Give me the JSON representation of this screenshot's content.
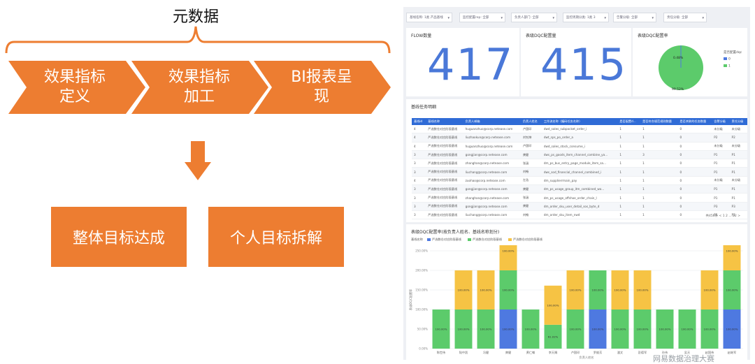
{
  "diagram": {
    "metadata_label": "元数据",
    "pipeline": [
      {
        "label": "效果指标定义",
        "line1": "效果指标",
        "line2": "定义"
      },
      {
        "label": "效果指标加工",
        "line1": "效果指标",
        "line2": "加工"
      },
      {
        "label": "BI报表呈现",
        "line1": "BI报表呈",
        "line2": "现"
      }
    ],
    "outcomes": [
      "整体目标达成",
      "个人目标拆解"
    ],
    "colors": {
      "accent": "#ed7d31"
    }
  },
  "dashboard": {
    "filters": [
      "基线名称: 1类 产品基线",
      "监控配置rep: 全部",
      "负责人部门: 全部",
      "监控周期分类: 1类 3",
      "告警分级: 全部",
      "责任分级: 全部"
    ],
    "kpis": [
      {
        "title": "FLOW数量",
        "value": "417"
      },
      {
        "title": "表级DQC配置量",
        "value": "415"
      }
    ],
    "pie": {
      "title": "表级DQC配置率",
      "legend_title": "是否配置dqc",
      "legend": [
        "0",
        "1"
      ],
      "labels": [
        "0.48%",
        "99.52%"
      ]
    },
    "table": {
      "title": "基线任务明细",
      "columns": [
        "基线id",
        "基线名称",
        "负责人邮箱",
        "负责人姓名",
        "工作流名称（编码任务名称）",
        "是否配置d...",
        "是否符合规范规则数量",
        "是否关联的任务数量",
        "告警分级",
        "责任分级"
      ],
      "rows": [
        [
          "4",
          "严选数仓对应阶段基线",
          "huguanzhuo@corp.netease.com",
          "卢国印",
          "dwd_sales_subpocket_order_i",
          "1",
          "1",
          "0",
          "未分级",
          "未分级"
        ],
        [
          "4",
          "严选数仓对应阶段基线",
          "liuzhaokun@corp.netease.com",
          "刘钊坤",
          "dwt_sps_po_order_a",
          "1",
          "1",
          "0",
          "P2",
          "P2"
        ],
        [
          "4",
          "严选数仓对应阶段基线",
          "huguanzhuo@corp.netease.com",
          "卢国印",
          "dwd_sales_stock_consume_i",
          "1",
          "1",
          "0",
          "未分级",
          "未分级"
        ],
        [
          "3",
          "严选数仓对应阶段基线",
          "gongjian@corp.netease.com",
          "龚健",
          "dws_ps_goods_item_channel_combine_ya...",
          "1",
          "3",
          "0",
          "P1",
          "P1"
        ],
        [
          "3",
          "严选数仓对应阶段基线",
          "zhanghan@corp.netease.com",
          "张涵",
          "dm_ps_bus_entry_page_module_item_sa...",
          "1",
          "1",
          "0",
          "P1",
          "P1"
        ],
        [
          "3",
          "严选数仓对应阶段基线",
          "liuchang@corp.netease.com",
          "刘畅",
          "dws_sod_financial_channel_combined_i",
          "1",
          "1",
          "0",
          "P1",
          "P1"
        ],
        [
          "4",
          "严选数仓对应阶段基线",
          "zuohao@corp.netease.com",
          "左浩",
          "dm_supplierrmain_pay",
          "1",
          "1",
          "0",
          "未分级",
          "未分级"
        ],
        [
          "3",
          "严选数仓对应阶段基线",
          "gongjian@corp.netease.com",
          "龚健",
          "dm_ps_usage_group_itm_combined_wo...",
          "1",
          "1",
          "0",
          "P1",
          "P1"
        ],
        [
          "3",
          "严选数仓对应阶段基线",
          "zhanghan@corp.netease.com",
          "张涵",
          "dm_ps_usage_offshoe_order_chain_l",
          "1",
          "1",
          "0",
          "P1",
          "P1"
        ],
        [
          "3",
          "严选数仓对应阶段基线",
          "gongjian@corp.netease.com",
          "龚健",
          "dm_order_sku_user_detail_sos_byte_d",
          "1",
          "1",
          "0",
          "P3",
          "P3"
        ],
        [
          "3",
          "严选数仓对应阶段基线",
          "liuchang@corp.netease.com",
          "刘畅",
          "dm_order_sku_item_nwd",
          "1",
          "1",
          "0",
          "P1",
          "P1"
        ]
      ],
      "pager": "共456条  <  1  2  ...  22  >"
    }
  },
  "chart_data": {
    "type": "bar",
    "title": "表级DQC配置率(按负责人姓名、基线名称划分)",
    "legend_title": "基线名称",
    "series_labels": [
      "严选数仓对应阶段基线",
      "严选数仓对应阶段基线",
      "严选数仓对应阶段基线"
    ],
    "ylabel": "表级DQC配置率",
    "xlabel": "负责人姓名",
    "yticks": [
      "0.00%",
      "50.00%",
      "100.00%",
      "150.00%",
      "200.00%",
      "250.00%"
    ],
    "ylim": [
      0,
      250
    ],
    "categories": [
      "陈世伟",
      "陆中凯",
      "冯健",
      "龚健",
      "黄仁翰",
      "李天赐",
      "卢国印",
      "罗维芳",
      "潘文",
      "彭德军",
      "孙伟",
      "吴天",
      "赵国伟",
      "赵继军"
    ],
    "series": [
      {
        "values": [
          0,
          0,
          0,
          100,
          0,
          0,
          0,
          100,
          0,
          0,
          0,
          0,
          0,
          100
        ]
      },
      {
        "values": [
          100,
          100,
          100,
          100,
          100,
          61.02,
          100,
          100,
          100,
          100,
          100,
          100,
          100,
          100
        ]
      },
      {
        "values": [
          0,
          100,
          100,
          100,
          0,
          100,
          100,
          0,
          100,
          100,
          0,
          0,
          100,
          100
        ]
      }
    ],
    "labels": [
      [
        "",
        "100.00%",
        ""
      ],
      [
        "",
        "100.00%",
        "100.00%"
      ],
      [
        "",
        "100.00%",
        "100.00%"
      ],
      [
        "100.00%",
        "100.00%",
        "100.00%"
      ],
      [
        "",
        "100.00%",
        ""
      ],
      [
        "",
        "61.02%",
        "100.00%"
      ],
      [
        "",
        "100.00%",
        "100.00%"
      ],
      [
        "100.00%",
        "100.00%",
        ""
      ],
      [
        "",
        "100.00%",
        "100.00%"
      ],
      [
        "",
        "100.00%",
        "100.00%"
      ],
      [
        "",
        "100.00%",
        ""
      ],
      [
        "",
        "100.00%",
        ""
      ],
      [
        "",
        "100.00%",
        "100.00%"
      ],
      [
        "100.00%",
        "100.00%",
        "100.00%"
      ]
    ],
    "colors": [
      "#4e79e0",
      "#5ccb6b",
      "#f6c344"
    ]
  },
  "watermark": "网易数据治理大赛"
}
